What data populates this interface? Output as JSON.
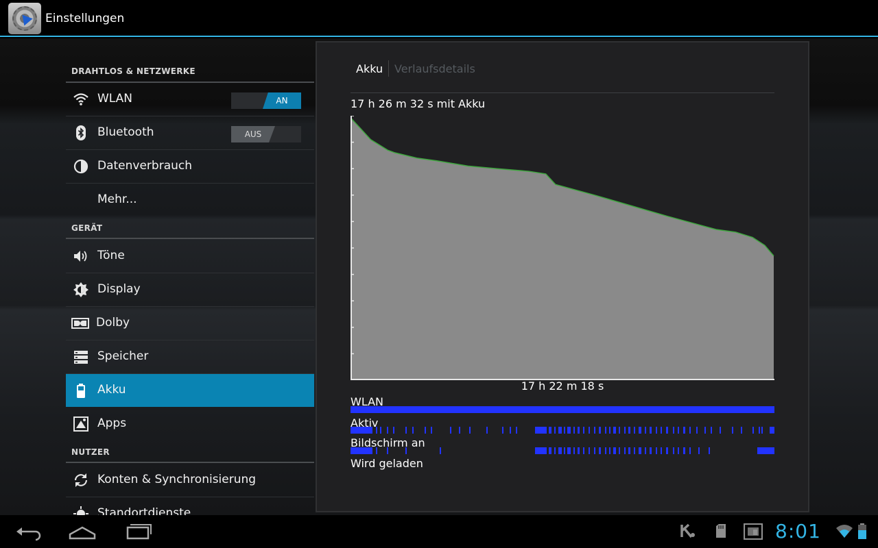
{
  "app": {
    "title": "Einstellungen"
  },
  "settings": {
    "categories": {
      "wireless": "DRAHTLOS & NETZWERKE",
      "device": "GERÄT",
      "user": "NUTZER"
    },
    "items": [
      {
        "label": "WLAN",
        "icon": "wifi-icon",
        "toggle": "AN",
        "toggle_state": "on"
      },
      {
        "label": "Bluetooth",
        "icon": "bluetooth-icon",
        "toggle": "AUS",
        "toggle_state": "off"
      },
      {
        "label": "Datenverbrauch",
        "icon": "data-usage-icon"
      },
      {
        "label": "Mehr..."
      },
      {
        "label": "Töne",
        "icon": "speaker-icon"
      },
      {
        "label": "Display",
        "icon": "brightness-icon"
      },
      {
        "label": "Dolby",
        "icon": "dolby-icon"
      },
      {
        "label": "Speicher",
        "icon": "storage-icon"
      },
      {
        "label": "Akku",
        "icon": "battery-icon",
        "selected": true
      },
      {
        "label": "Apps",
        "icon": "apps-icon"
      },
      {
        "label": "Konten & Synchronisierung",
        "icon": "sync-icon"
      },
      {
        "label": "Standortdienste",
        "icon": "location-icon"
      }
    ]
  },
  "panel": {
    "tabs": [
      "Akku",
      "Verlaufsdetails"
    ],
    "chart_caption": "17 h 26 m 32 s mit Akku",
    "chart_footer": "17 h 22 m 18 s",
    "tracks": [
      "WLAN",
      "Aktiv",
      "Bildschirm an",
      "Wird geladen"
    ]
  },
  "chart_data": {
    "type": "area",
    "title": "17 h 26 m 32 s mit Akku",
    "xlabel": "17 h 22 m 18 s",
    "ylabel": "",
    "ylim": [
      0,
      100
    ],
    "x_unit": "hours",
    "x": [
      0,
      0.4,
      0.8,
      1.5,
      1.8,
      2.7,
      3.5,
      4.8,
      6.0,
      7.3,
      8.0,
      8.4,
      10.0,
      11.5,
      13.0,
      15.0,
      15.8,
      16.5,
      17.0,
      17.37
    ],
    "series": [
      {
        "values": [
          99,
          95,
          91,
          87,
          86,
          84,
          83,
          81,
          80,
          79,
          78,
          74,
          70,
          66,
          62,
          57,
          56,
          54,
          51,
          47
        ]
      }
    ],
    "line_color": "#3fa83f",
    "fill_color": "#8a8a8a",
    "grid": false
  },
  "tracks_data": {
    "color": "#2233ff",
    "wlan": [
      [
        0,
        1
      ]
    ],
    "aktiv": [
      [
        0,
        0.052
      ],
      [
        0.06,
        0.062
      ],
      [
        0.07,
        0.072
      ],
      [
        0.085,
        0.087
      ],
      [
        0.1,
        0.102
      ],
      [
        0.13,
        0.133
      ],
      [
        0.145,
        0.147
      ],
      [
        0.175,
        0.178
      ],
      [
        0.19,
        0.192
      ],
      [
        0.235,
        0.237
      ],
      [
        0.255,
        0.257
      ],
      [
        0.28,
        0.282
      ],
      [
        0.32,
        0.322
      ],
      [
        0.358,
        0.361
      ],
      [
        0.375,
        0.377
      ],
      [
        0.39,
        0.393
      ],
      [
        0.435,
        0.463
      ],
      [
        0.468,
        0.474
      ],
      [
        0.48,
        0.483
      ],
      [
        0.49,
        0.498
      ],
      [
        0.503,
        0.506
      ],
      [
        0.512,
        0.52
      ],
      [
        0.526,
        0.529
      ],
      [
        0.536,
        0.54
      ],
      [
        0.548,
        0.551
      ],
      [
        0.562,
        0.565
      ],
      [
        0.575,
        0.577
      ],
      [
        0.585,
        0.59
      ],
      [
        0.6,
        0.603
      ],
      [
        0.61,
        0.612
      ],
      [
        0.62,
        0.626
      ],
      [
        0.632,
        0.636
      ],
      [
        0.645,
        0.648
      ],
      [
        0.655,
        0.66
      ],
      [
        0.668,
        0.671
      ],
      [
        0.68,
        0.686
      ],
      [
        0.694,
        0.697
      ],
      [
        0.705,
        0.71
      ],
      [
        0.72,
        0.724
      ],
      [
        0.732,
        0.734
      ],
      [
        0.745,
        0.75
      ],
      [
        0.76,
        0.763
      ],
      [
        0.772,
        0.775
      ],
      [
        0.785,
        0.79
      ],
      [
        0.8,
        0.803
      ],
      [
        0.815,
        0.819
      ],
      [
        0.835,
        0.838
      ],
      [
        0.85,
        0.853
      ],
      [
        0.87,
        0.873
      ],
      [
        0.9,
        0.903
      ],
      [
        0.92,
        0.922
      ],
      [
        0.948,
        0.951
      ],
      [
        0.97,
        0.972
      ],
      [
        0.99,
        0.993
      ],
      [
        0.963,
        0.966
      ],
      [
        0.988,
        1.0
      ]
    ],
    "bildschirm": [
      [
        0,
        0.052
      ],
      [
        0.06,
        0.062
      ],
      [
        0.085,
        0.087
      ],
      [
        0.13,
        0.133
      ],
      [
        0.21,
        0.213
      ],
      [
        0.435,
        0.463
      ],
      [
        0.468,
        0.474
      ],
      [
        0.48,
        0.483
      ],
      [
        0.49,
        0.498
      ],
      [
        0.503,
        0.506
      ],
      [
        0.512,
        0.52
      ],
      [
        0.526,
        0.529
      ],
      [
        0.536,
        0.54
      ],
      [
        0.548,
        0.551
      ],
      [
        0.562,
        0.565
      ],
      [
        0.575,
        0.577
      ],
      [
        0.585,
        0.59
      ],
      [
        0.6,
        0.603
      ],
      [
        0.61,
        0.612
      ],
      [
        0.62,
        0.626
      ],
      [
        0.632,
        0.636
      ],
      [
        0.645,
        0.648
      ],
      [
        0.655,
        0.66
      ],
      [
        0.668,
        0.671
      ],
      [
        0.68,
        0.686
      ],
      [
        0.694,
        0.697
      ],
      [
        0.705,
        0.71
      ],
      [
        0.72,
        0.724
      ],
      [
        0.732,
        0.734
      ],
      [
        0.745,
        0.75
      ],
      [
        0.76,
        0.763
      ],
      [
        0.772,
        0.775
      ],
      [
        0.785,
        0.79
      ],
      [
        0.8,
        0.803
      ],
      [
        0.82,
        0.823
      ],
      [
        0.845,
        0.848
      ],
      [
        0.96,
        1.0
      ]
    ],
    "geladen": []
  },
  "status_bar": {
    "clock": "8:01",
    "icons": [
      "kaspersky-icon",
      "sd-card-icon",
      "screenshot-icon",
      "wifi-signal-icon",
      "battery-icon"
    ]
  },
  "navigation": [
    "back-icon",
    "home-icon",
    "recent-apps-icon"
  ]
}
